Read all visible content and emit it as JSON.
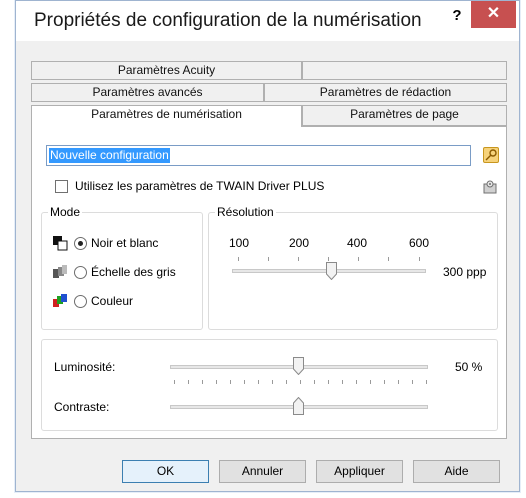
{
  "dialog": {
    "title": "Propriétés de configuration de la numérisation",
    "help_label": "?",
    "close_label": "✕"
  },
  "tabs": {
    "row1": [
      "Paramètres Acuity",
      ""
    ],
    "row2": [
      "Paramètres avancés",
      "Paramètres de rédaction"
    ],
    "row3": [
      "Paramètres de numérisation",
      "Paramètres de page"
    ],
    "active": "Paramètres de numérisation"
  },
  "config_name": {
    "value": "Nouvelle configuration"
  },
  "twain_option": {
    "label": "Utilisez les paramètres de TWAIN Driver PLUS",
    "checked": false
  },
  "mode": {
    "legend": "Mode",
    "options": [
      {
        "label": "Noir et blanc",
        "icon": "black-white-mode-icon",
        "selected": true
      },
      {
        "label": "Échelle des gris",
        "icon": "grayscale-mode-icon",
        "selected": false
      },
      {
        "label": "Couleur",
        "icon": "color-mode-icon",
        "selected": false
      }
    ]
  },
  "resolution": {
    "legend": "Résolution",
    "ticks": [
      "100",
      "200",
      "400",
      "600"
    ],
    "value_label": "300 ppp",
    "value": 300
  },
  "brightness": {
    "label": "Luminosité:",
    "value_label": "50 %",
    "value": 50
  },
  "contrast": {
    "label": "Contraste:",
    "value": 50
  },
  "buttons": {
    "ok": "OK",
    "cancel": "Annuler",
    "apply": "Appliquer",
    "help": "Aide"
  },
  "colors": {
    "close": "#c75050",
    "selection": "#3399ff",
    "accent": "#3c7fb1"
  }
}
